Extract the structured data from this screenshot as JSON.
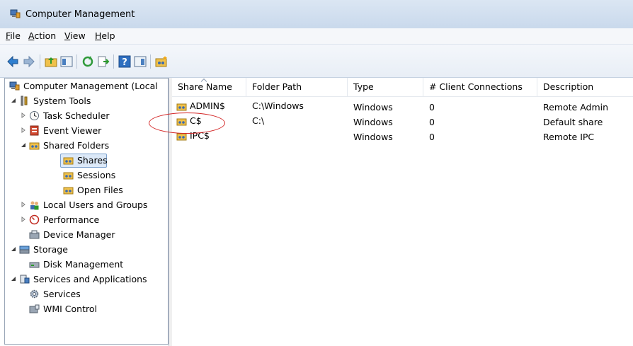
{
  "window": {
    "title": "Computer Management"
  },
  "menu": [
    {
      "label": "File",
      "accel": "F",
      "rest": "ile"
    },
    {
      "label": "Action",
      "accel": "A",
      "rest": "ction"
    },
    {
      "label": "View",
      "accel": "V",
      "rest": "iew"
    },
    {
      "label": "Help",
      "accel": "H",
      "rest": "elp"
    }
  ],
  "toolbar": {
    "buttons": [
      "back-icon",
      "forward-icon",
      "up-folder-icon",
      "show-hide-tree-icon",
      "refresh-icon",
      "export-list-icon",
      "help-icon",
      "show-hide-action-pane-icon",
      "new-share-icon"
    ]
  },
  "tree": {
    "root": "Computer Management (Local",
    "system_tools": "System Tools",
    "task_scheduler": "Task Scheduler",
    "event_viewer": "Event Viewer",
    "shared_folders": "Shared Folders",
    "shares": "Shares",
    "sessions": "Sessions",
    "open_files": "Open Files",
    "local_users": "Local Users and Groups",
    "performance": "Performance",
    "device_manager": "Device Manager",
    "storage": "Storage",
    "disk_management": "Disk Management",
    "services_apps": "Services and Applications",
    "services": "Services",
    "wmi_control": "WMI Control"
  },
  "list": {
    "columns": {
      "share_name": "Share Name",
      "folder_path": "Folder Path",
      "type": "Type",
      "client_connections": "# Client Connections",
      "description": "Description"
    },
    "rows": [
      {
        "name": "ADMIN$",
        "path": "C:\\Windows",
        "type": "Windows",
        "connections": "0",
        "description": "Remote Admin"
      },
      {
        "name": "C$",
        "path": "C:\\",
        "type": "Windows",
        "connections": "0",
        "description": "Default share"
      },
      {
        "name": "IPC$",
        "path": "",
        "type": "Windows",
        "connections": "0",
        "description": "Remote IPC"
      }
    ]
  },
  "colors": {
    "annotation": "#d42a2a",
    "selection": "#dce9f8"
  }
}
